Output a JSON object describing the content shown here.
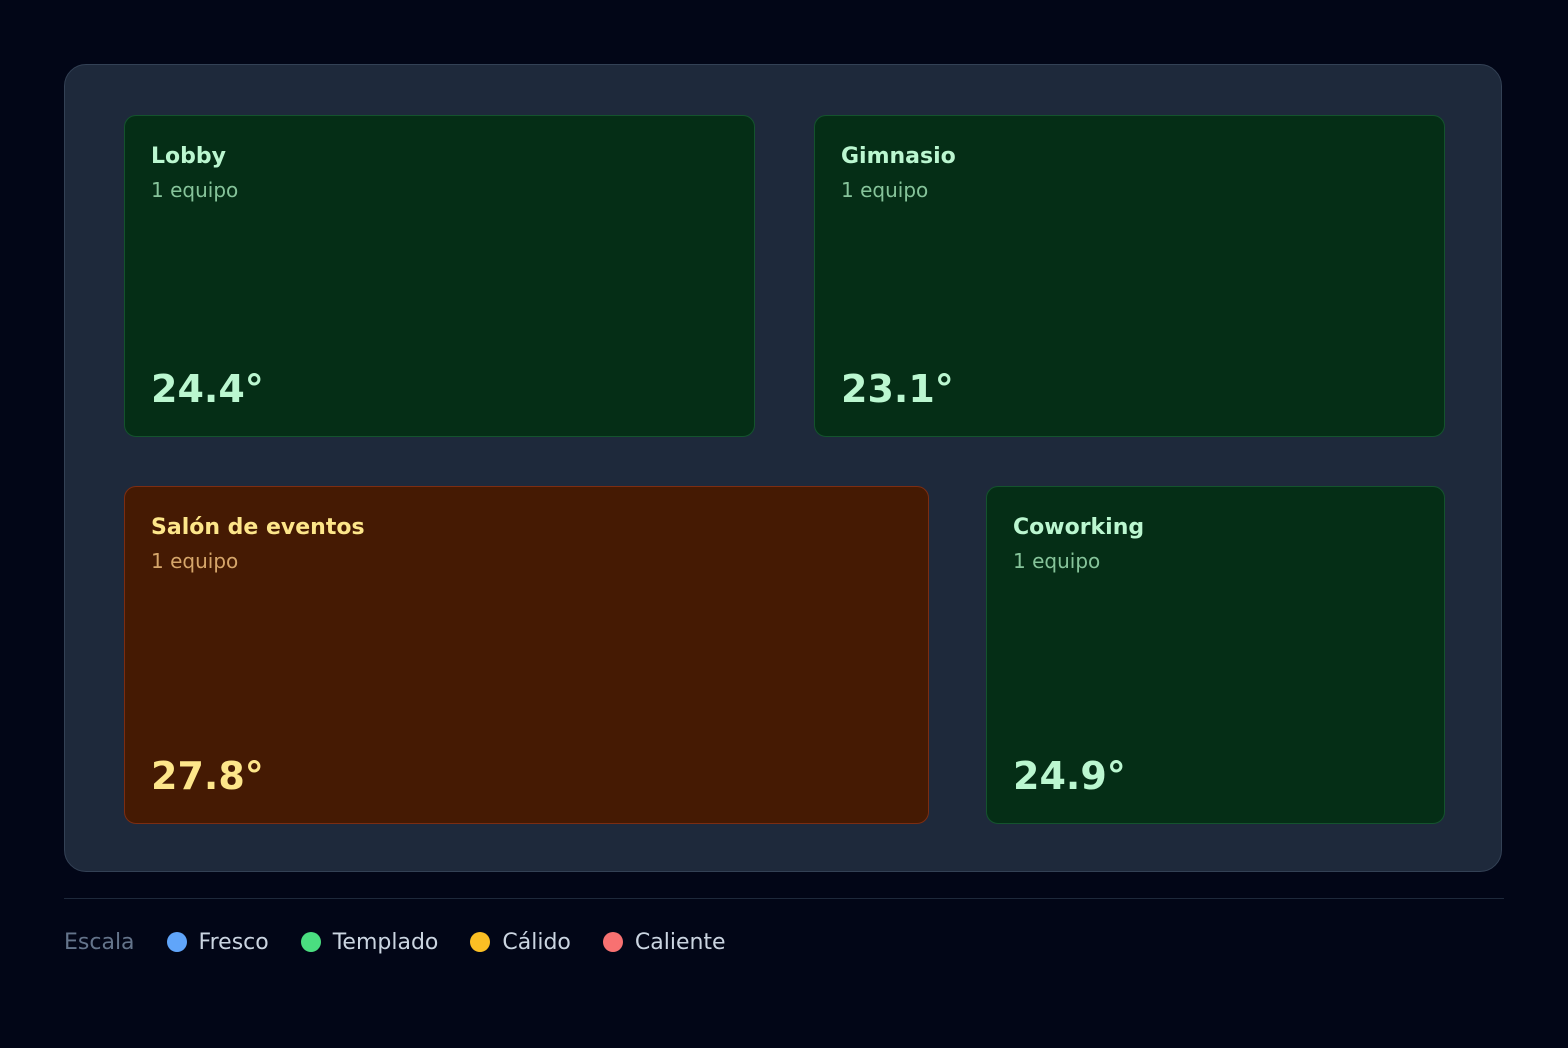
{
  "zones": [
    {
      "id": "lobby",
      "name": "Lobby",
      "devices": "1 equipo",
      "temperature": "24.4°",
      "level": "templado"
    },
    {
      "id": "gimnasio",
      "name": "Gimnasio",
      "devices": "1 equipo",
      "temperature": "23.1°",
      "level": "templado"
    },
    {
      "id": "salon",
      "name": "Salón de eventos",
      "devices": "1 equipo",
      "temperature": "27.8°",
      "level": "calido"
    },
    {
      "id": "coworking",
      "name": "Coworking",
      "devices": "1 equipo",
      "temperature": "24.9°",
      "level": "templado"
    }
  ],
  "legend": {
    "title": "Escala",
    "items": [
      {
        "label": "Fresco",
        "color": "#60a5fa"
      },
      {
        "label": "Templado",
        "color": "#4ade80"
      },
      {
        "label": "Cálido",
        "color": "#fbbf24"
      },
      {
        "label": "Caliente",
        "color": "#f87171"
      }
    ]
  },
  "colors": {
    "background": "#020617",
    "panel": "#1e293b",
    "templado_tile": "#052e16",
    "calido_tile": "#451a03"
  }
}
